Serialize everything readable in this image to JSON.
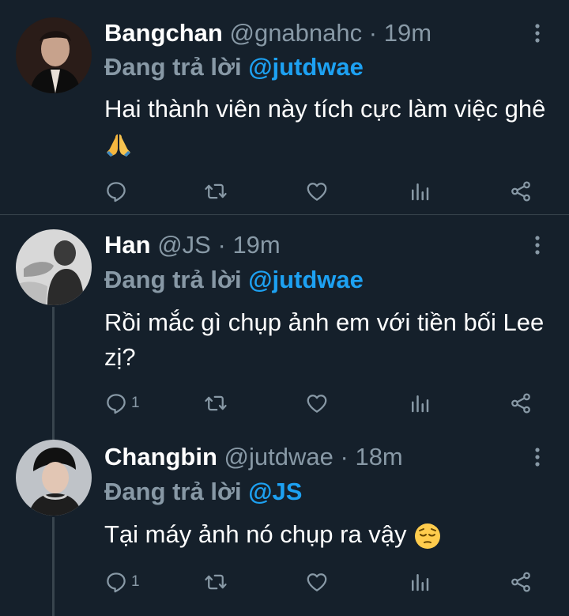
{
  "colors": {
    "background": "#15202b",
    "secondary_text": "#8899a6",
    "accent": "#1da1f2",
    "divider": "#38444d"
  },
  "tweets": [
    {
      "name": "Bangchan",
      "handle": "@gnabnahc",
      "separator": "·",
      "time": "19m",
      "reply_prefix": "Đang trả lời",
      "reply_to": "@jutdwae",
      "text": "Hai thành viên này tích cực làm việc ghê",
      "emoji": "folded-hands",
      "reply_count": "",
      "icons": [
        "more-vertical-icon",
        "reply-icon",
        "retweet-icon",
        "like-icon",
        "analytics-icon",
        "share-icon"
      ]
    },
    {
      "name": "Han",
      "handle": "@JS",
      "separator": "·",
      "time": "19m",
      "reply_prefix": "Đang trả lời",
      "reply_to": "@jutdwae",
      "text": "Rồi mắc gì chụp ảnh em với tiền bối Lee zị?",
      "reply_count": "1",
      "icons": [
        "more-vertical-icon",
        "reply-icon",
        "retweet-icon",
        "like-icon",
        "analytics-icon",
        "share-icon"
      ]
    },
    {
      "name": "Changbin",
      "handle": "@jutdwae",
      "separator": "·",
      "time": "18m",
      "reply_prefix": "Đang trả lời",
      "reply_to": "@JS",
      "text": "Tại máy ảnh nó chụp ra vậy",
      "emoji": "pensive-face",
      "reply_count": "1",
      "icons": [
        "more-vertical-icon",
        "reply-icon",
        "retweet-icon",
        "like-icon",
        "analytics-icon",
        "share-icon"
      ]
    }
  ]
}
